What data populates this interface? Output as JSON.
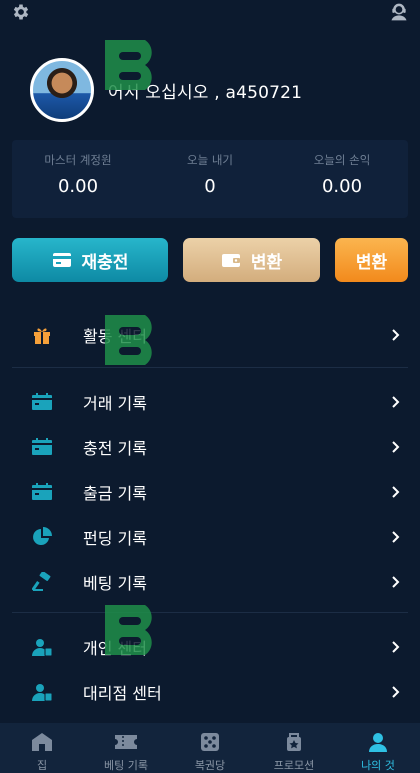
{
  "header": {
    "settings_icon": "gear-icon",
    "support_icon": "customer-service-icon"
  },
  "profile": {
    "welcome_text": "어서 오십시오 , a450721"
  },
  "stats": [
    {
      "label": "마스터 계정원",
      "value": "0.00"
    },
    {
      "label": "오늘 내기",
      "value": "0"
    },
    {
      "label": "오늘의 손익",
      "value": "0.00"
    }
  ],
  "actions": {
    "recharge_label": "재충전",
    "convert_label": "변환",
    "convert2_label": "변환"
  },
  "menu": {
    "activity_center": "활동 센터",
    "transaction_records": "거래 기록",
    "recharge_records": "충전 기록",
    "withdraw_records": "출금 기록",
    "funding_records": "펀딩 기록",
    "betting_records": "베팅 기록",
    "personal_center": "개인 센터",
    "agent_center": "대리점 센터"
  },
  "bottom_nav": [
    {
      "label": "집",
      "icon": "home-icon"
    },
    {
      "label": "베팅 기록",
      "icon": "ticket-icon"
    },
    {
      "label": "복권당",
      "icon": "dice-icon"
    },
    {
      "label": "프로모션",
      "icon": "promotion-icon"
    },
    {
      "label": "나의 것",
      "icon": "user-icon",
      "active": true
    }
  ],
  "colors": {
    "background": "#0c1a2e",
    "accent_cyan": "#1aa3bb",
    "gold": "#d9b98a",
    "orange": "#f59a2b",
    "gift_orange": "#f5a03a",
    "active_nav": "#2fc1e4"
  }
}
